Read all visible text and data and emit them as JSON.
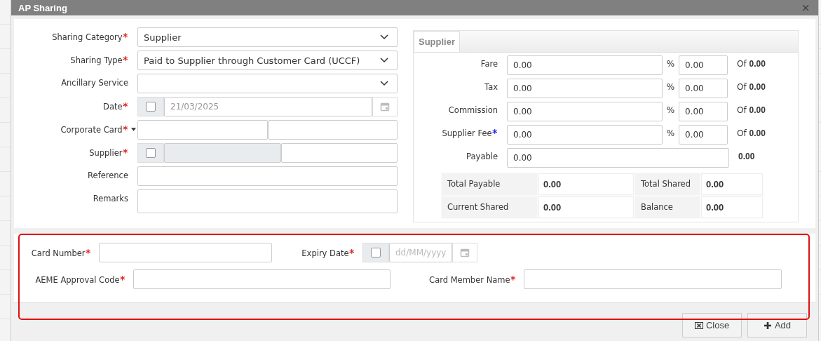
{
  "dialog": {
    "title": "AP Sharing",
    "close_glyph": "×"
  },
  "form": [
    {
      "kind": "select",
      "label": "Sharing Category",
      "asterisk": {
        "text": "*",
        "color": "#e02020"
      },
      "value": "Supplier"
    },
    {
      "kind": "select",
      "label": "Sharing Type",
      "asterisk": {
        "text": "*",
        "color": "#e02020"
      },
      "value": "Paid to Supplier through Customer Card (UCCF)"
    },
    {
      "kind": "select",
      "label": "Ancillary Service"
    },
    {
      "kind": "date",
      "label": "Date",
      "asterisk": {
        "text": "*",
        "color": "#e02020"
      },
      "checked": false,
      "disabled": true,
      "value": "21/03/2025"
    },
    {
      "kind": "split",
      "label": "Corporate Card",
      "asterisk": {
        "text": "*",
        "color": "#e02020"
      },
      "dropdown": true
    },
    {
      "kind": "checkbox-split",
      "label": "Supplier",
      "asterisk": {
        "text": "*",
        "color": "#e02020"
      },
      "checked": false
    },
    {
      "kind": "text",
      "label": "Reference"
    },
    {
      "kind": "textarea",
      "label": "Remarks"
    }
  ],
  "supplier_panel": {
    "tab": {
      "label": "Supplier",
      "selected": true
    },
    "rows": [
      {
        "kind": "split",
        "label": "Fare",
        "amount": "0.00",
        "percent_sign": "%",
        "percent": "0.00",
        "of_label": "Of",
        "of_value": "0.00"
      },
      {
        "kind": "split",
        "label": "Tax",
        "amount": "0.00",
        "percent_sign": "%",
        "percent": "0.00",
        "of_label": "Of",
        "of_value": "0.00"
      },
      {
        "kind": "split",
        "label": "Commission",
        "amount": "0.00",
        "percent_sign": "%",
        "percent": "0.00",
        "of_label": "Of",
        "of_value": "0.00"
      },
      {
        "kind": "split",
        "label": "Supplier Fee",
        "asterisk": {
          "text": "*",
          "color": "#2020e0"
        },
        "amount": "0.00",
        "percent_sign": "%",
        "percent": "0.00",
        "of_label": "Of",
        "of_value": "0.00"
      },
      {
        "kind": "single",
        "label": "Payable",
        "amount": "0.00",
        "total": "0.00"
      }
    ],
    "summary": [
      [
        {
          "label": "Total Payable",
          "value": "0.00"
        },
        {
          "label": "Total Shared",
          "value": "0.00"
        }
      ],
      [
        {
          "label": "Current Shared",
          "value": "0.00"
        },
        {
          "label": "Balance",
          "value": "0.00"
        }
      ]
    ]
  },
  "card_details": {
    "highlighted": true,
    "rows": [
      [
        {
          "kind": "text",
          "label": "Card Number",
          "asterisk": {
            "text": "*",
            "color": "#e02020"
          }
        },
        {
          "kind": "date",
          "label": "Expiry Date",
          "asterisk": {
            "text": "*",
            "color": "#e02020"
          },
          "checked": false,
          "placeholder": "dd/MM/yyyy"
        }
      ],
      [
        {
          "kind": "text",
          "label": "AEME Approval Code",
          "asterisk": {
            "text": "*",
            "color": "#e02020"
          }
        },
        {
          "kind": "text",
          "label": "Card Member Name",
          "asterisk": {
            "text": "*",
            "color": "#e02020"
          }
        }
      ]
    ]
  },
  "buttons": [
    {
      "kind": "close",
      "label": "Close"
    },
    {
      "kind": "add",
      "label": "Add"
    }
  ]
}
